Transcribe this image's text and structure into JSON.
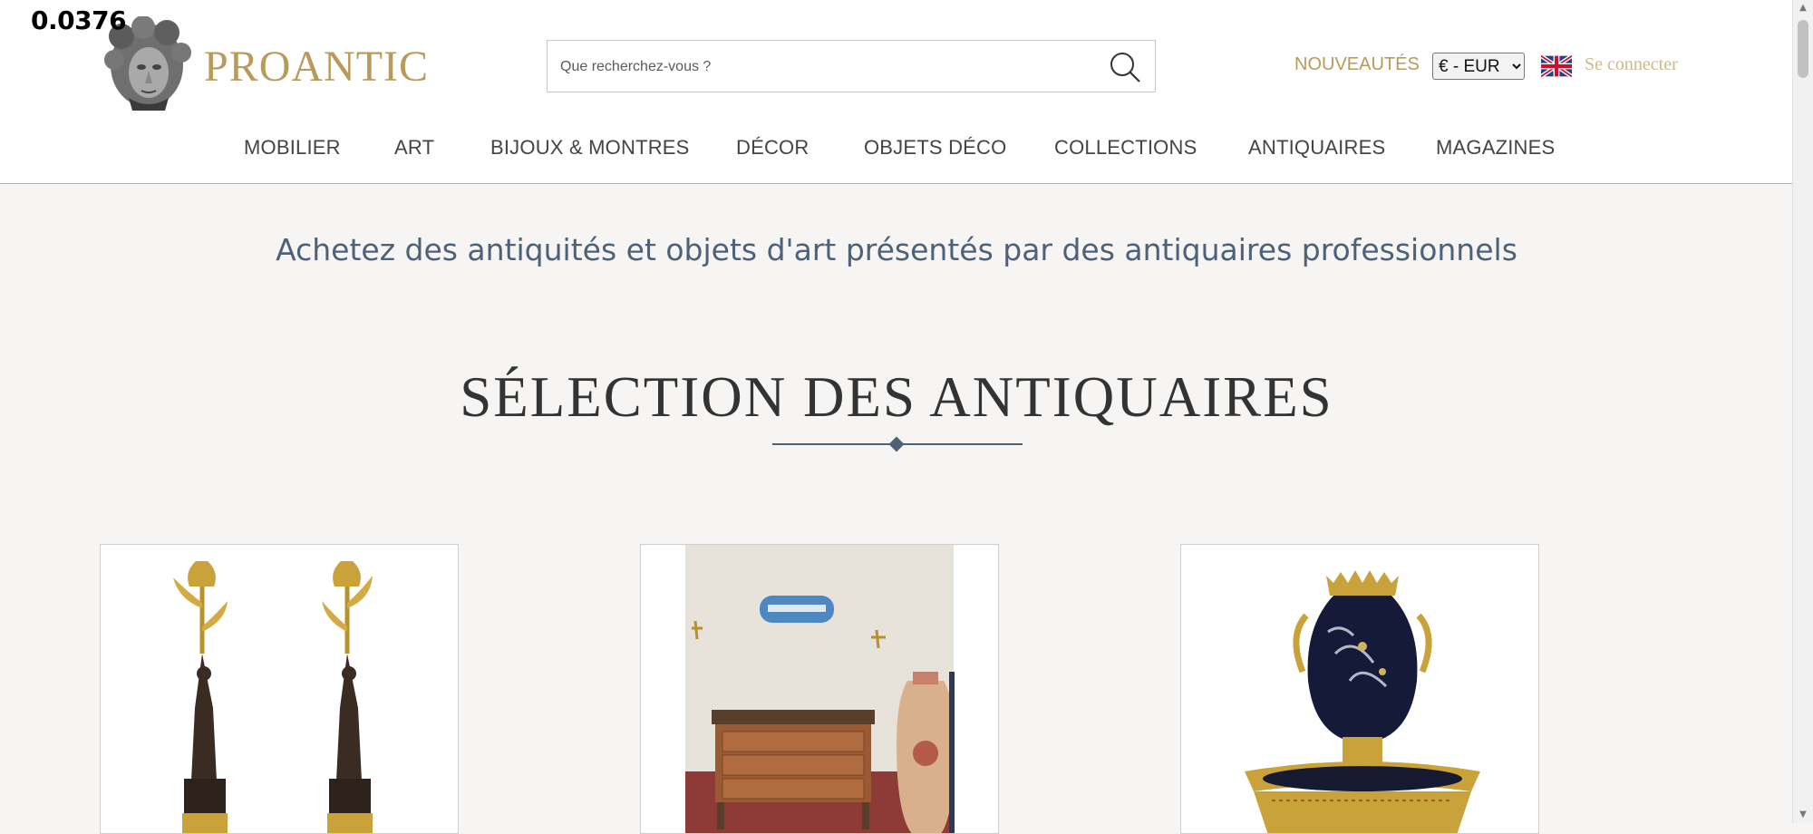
{
  "overlay": {
    "value": "0.0376"
  },
  "header": {
    "brand": "PROANTIC",
    "search_placeholder": "Que recherchez-vous ?",
    "new_label": "NOUVEAUTÉS",
    "currency": {
      "selected": "€ - EUR",
      "options": [
        "€ - EUR"
      ]
    },
    "login_label": "Se connecter"
  },
  "nav": {
    "items": [
      {
        "label": "MOBILIER"
      },
      {
        "label": "ART"
      },
      {
        "label": "BIJOUX & MONTRES"
      },
      {
        "label": "DÉCOR"
      },
      {
        "label": "OBJETS DÉCO"
      },
      {
        "label": "COLLECTIONS"
      },
      {
        "label": "ANTIQUAIRES"
      },
      {
        "label": "MAGAZINES"
      }
    ]
  },
  "main": {
    "tagline": "Achetez des antiquités et objets d'art présentés par des antiquaires professionnels",
    "section_title": "SÉLECTION DES ANTIQUAIRES"
  },
  "icons": {
    "search": "search-icon",
    "flag": "uk-flag-icon",
    "logo": "logo-head-icon"
  },
  "colors": {
    "brand_gold": "#b89a5b",
    "tagline_blue": "#4d6177",
    "background": "#f6f5f3"
  }
}
